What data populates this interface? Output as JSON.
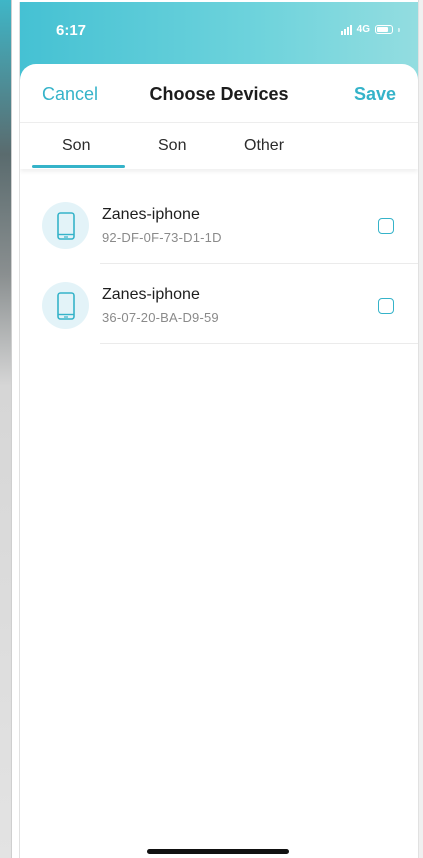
{
  "status_bar": {
    "time": "6:17",
    "network": "4G",
    "signal_icon": "signal-bars-icon",
    "battery_icon": "battery-icon"
  },
  "header": {
    "cancel_label": "Cancel",
    "title": "Choose Devices",
    "save_label": "Save"
  },
  "tabs": [
    {
      "label": "Son",
      "active": true
    },
    {
      "label": "Son",
      "active": false
    },
    {
      "label": "Other",
      "active": false
    }
  ],
  "devices": [
    {
      "name": "Zanes-iphone",
      "mac": "92-DF-0F-73-D1-1D",
      "icon": "phone-icon",
      "checked": false
    },
    {
      "name": "Zanes-iphone",
      "mac": "36-07-20-BA-D9-59",
      "icon": "phone-icon",
      "checked": false
    }
  ],
  "colors": {
    "accent": "#35b3c9",
    "status_bar": "#45c1d3",
    "icon_bg": "#e3f3f8"
  }
}
